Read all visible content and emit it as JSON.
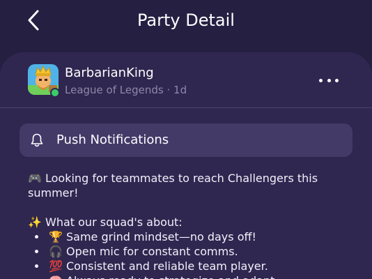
{
  "header": {
    "title": "Party Detail",
    "back_icon": "chevron-left-icon"
  },
  "post": {
    "username": "BarbarianKing",
    "game": "League of Legends",
    "separator": "·",
    "age": "1d",
    "online": true,
    "more_icon": "more-horizontal-icon"
  },
  "notifications": {
    "label": "Push Notifications",
    "icon": "bell-icon"
  },
  "body": {
    "intro": "🎮 Looking for teammates to reach Challengers this summer!",
    "section_heading": "✨ What our squad's about:",
    "bullets": [
      "🏆 Same grind mindset—no days off!",
      "🎧 Open mic for constant comms.",
      "💯 Consistent and reliable team player.",
      "🧠 Always ready to strategize and adapt"
    ]
  },
  "colors": {
    "background": "#251f42",
    "card": "#2f2750",
    "button": "#433a68",
    "muted_text": "#8f88a8",
    "online": "#3ccd6a"
  }
}
